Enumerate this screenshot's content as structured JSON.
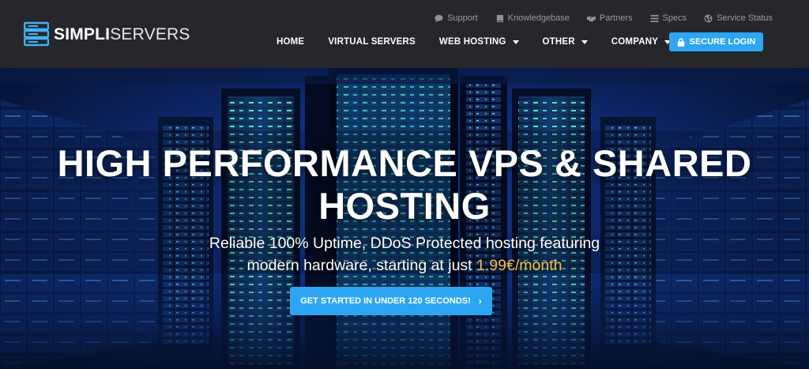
{
  "brand": {
    "name_bold": "SIMPLI",
    "name_light": "SERVERS"
  },
  "colors": {
    "accent": "#2ca6f2",
    "header_bg": "#26272b",
    "price": "#f6c24a"
  },
  "toplinks": [
    {
      "label": "Support",
      "icon": "chat-bubble-icon"
    },
    {
      "label": "Knowledgebase",
      "icon": "book-icon"
    },
    {
      "label": "Partners",
      "icon": "handshake-icon"
    },
    {
      "label": "Specs",
      "icon": "list-icon"
    },
    {
      "label": "Service Status",
      "icon": "globe-icon"
    }
  ],
  "nav": [
    {
      "label": "HOME",
      "dropdown": false
    },
    {
      "label": "VIRTUAL SERVERS",
      "dropdown": false
    },
    {
      "label": "WEB HOSTING",
      "dropdown": true
    },
    {
      "label": "OTHER",
      "dropdown": true
    },
    {
      "label": "COMPANY",
      "dropdown": true
    }
  ],
  "login": {
    "label": "SECURE LOGIN",
    "icon": "lock-icon"
  },
  "hero": {
    "title_line1": "HIGH PERFORMANCE VPS & SHARED",
    "title_line2": "HOSTING",
    "subtitle_line1": "Reliable 100% Uptime, DDoS Protected hosting featuring",
    "subtitle_line2": "modern hardware, starting at just ",
    "price": "1.99€/month",
    "cta_label": "GET STARTED IN UNDER 120 SECONDS!",
    "cta_icon": "chevron-right-icon"
  }
}
